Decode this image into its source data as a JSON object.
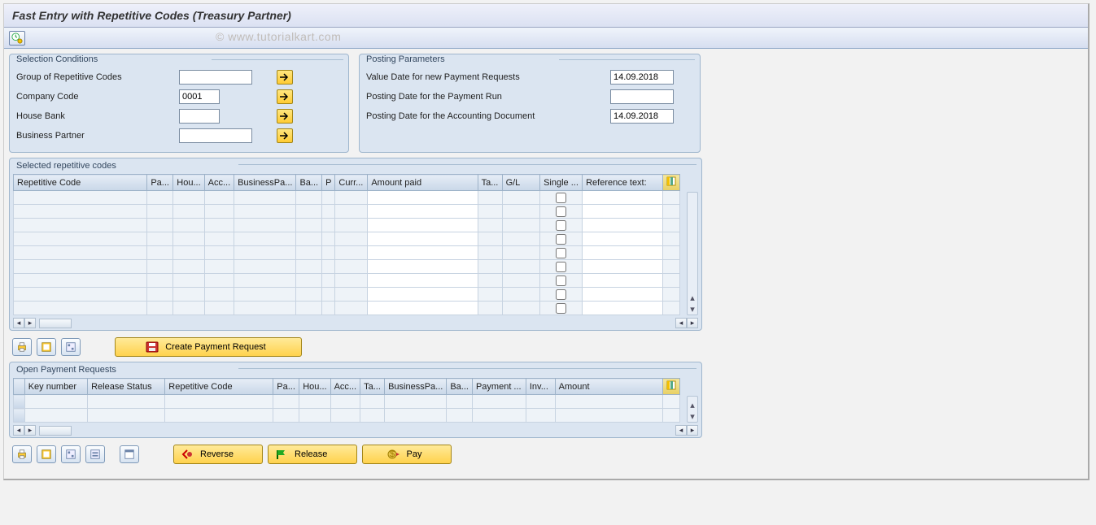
{
  "title": "Fast Entry with Repetitive Codes (Treasury Partner)",
  "watermark": "© www.tutorialkart.com",
  "panels": {
    "selection": {
      "heading": "Selection Conditions",
      "rows": {
        "group_rep_codes": {
          "label": "Group of Repetitive Codes",
          "value": ""
        },
        "company_code": {
          "label": "Company Code",
          "value": "0001"
        },
        "house_bank": {
          "label": "House Bank",
          "value": ""
        },
        "business_partner": {
          "label": "Business Partner",
          "value": ""
        }
      }
    },
    "posting": {
      "heading": "Posting Parameters",
      "rows": {
        "value_date": {
          "label": "Value Date for new Payment Requests",
          "value": "14.09.2018"
        },
        "posting_date_run": {
          "label": "Posting Date for the Payment Run",
          "value": ""
        },
        "posting_date_doc": {
          "label": "Posting Date for the Accounting Document",
          "value": "14.09.2018"
        }
      }
    },
    "selected_codes": {
      "heading": "Selected repetitive codes",
      "columns": [
        "Repetitive Code",
        "Pa...",
        "Hou...",
        "Acc...",
        "BusinessPa...",
        "Ba...",
        "P",
        "Curr...",
        "Amount paid",
        "Ta...",
        "G/L",
        "Single ...",
        "Reference text:"
      ],
      "rows": 9
    },
    "open_requests": {
      "heading": "Open Payment Requests",
      "columns": [
        "",
        "Key number",
        "Release Status",
        "Repetitive Code",
        "Pa...",
        "Hou...",
        "Acc...",
        "Ta...",
        "BusinessPa...",
        "Ba...",
        "Payment ...",
        "Inv...",
        "Amount"
      ]
    }
  },
  "buttons": {
    "create_payment_request": "Create Payment Request",
    "reverse": "Reverse",
    "release": "Release",
    "pay": "Pay"
  }
}
